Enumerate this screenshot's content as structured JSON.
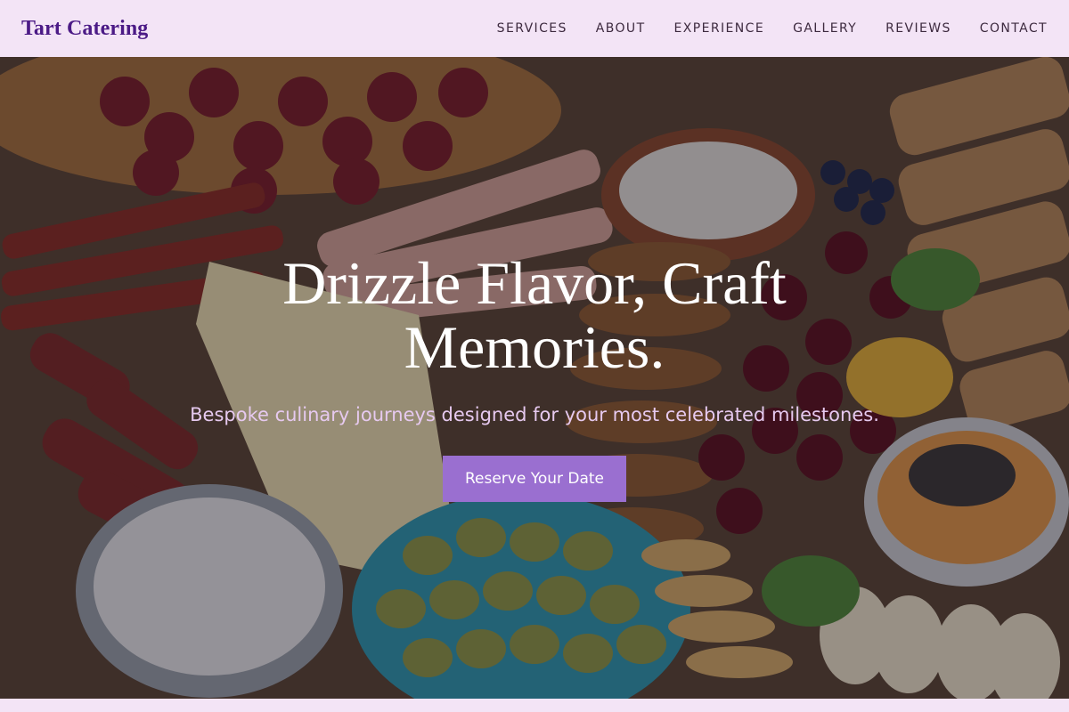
{
  "brand": {
    "name": "Tart Catering"
  },
  "nav": {
    "items": [
      {
        "label": "SERVICES"
      },
      {
        "label": "ABOUT"
      },
      {
        "label": "EXPERIENCE"
      },
      {
        "label": "GALLERY"
      },
      {
        "label": "REVIEWS"
      },
      {
        "label": "CONTACT"
      }
    ]
  },
  "hero": {
    "title": "Drizzle Flavor, Craft Memories.",
    "subtitle": "Bespoke culinary journeys designed for your most celebrated milestones.",
    "cta_label": "Reserve Your Date"
  },
  "colors": {
    "brand": "#4b1a86",
    "nav_bg": "#f3e4f6",
    "cta_bg": "#9a6fd0",
    "subtitle": "#e6c9ef"
  }
}
